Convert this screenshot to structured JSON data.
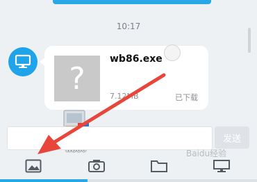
{
  "chat": {
    "timestamp": "10:17",
    "message": {
      "file_name": "wb86.exe",
      "file_size": "7.12MB",
      "status": "已下载",
      "thumbnail_glyph": "?"
    }
  },
  "composer": {
    "input_value": "",
    "send_label": "发送"
  },
  "drag_preview": {
    "label": "wb86"
  },
  "toolbar": {
    "items": [
      {
        "icon": "image-icon"
      },
      {
        "icon": "camera-icon"
      },
      {
        "icon": "folder-icon"
      },
      {
        "icon": "screen-icon"
      }
    ]
  },
  "watermark": {
    "text": "Baidu经验"
  },
  "colors": {
    "accent": "#2aa7e6",
    "arrow": "#e8463a",
    "bubble": "#ffffff",
    "background": "#eef1f4"
  }
}
